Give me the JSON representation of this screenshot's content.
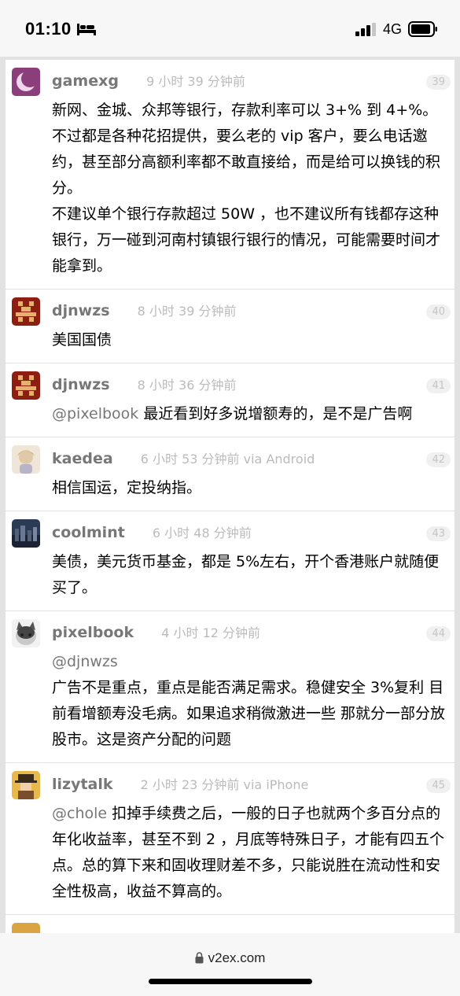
{
  "status_bar": {
    "time": "01:10",
    "network": "4G"
  },
  "browser": {
    "url": "v2ex.com"
  },
  "replies": [
    {
      "username": "gamexg",
      "time": "9 小时 39 分钟前",
      "floor": "39",
      "paragraphs": [
        "新网、金城、众邦等银行，存款利率可以 3+% 到 4+%。",
        "不过都是各种花招提供，要么老的 vip 客户，要么电话邀约，甚至部分高额利率都不敢直接给，而是给可以换钱的积分。",
        "不建议单个银行存款超过 50W ，也不建议所有钱都存这种银行，万一碰到河南村镇银行银行的情况，可能需要时间才能拿到。"
      ]
    },
    {
      "username": "djnwzs",
      "time": "8 小时 39 分钟前",
      "floor": "40",
      "paragraphs": [
        "美国国债"
      ]
    },
    {
      "username": "djnwzs",
      "time": "8 小时 36 分钟前",
      "floor": "41",
      "mention": "@pixelbook",
      "paragraphs": [
        " 最近看到好多说增额寿的，是不是广告啊"
      ]
    },
    {
      "username": "kaedea",
      "time": "6 小时 53 分钟前 via Android",
      "floor": "42",
      "paragraphs": [
        "相信国运，定投纳指。"
      ]
    },
    {
      "username": "coolmint",
      "time": "6 小时 48 分钟前",
      "floor": "43",
      "paragraphs": [
        "美债，美元货币基金，都是 5%左右，开个香港账户就随便买了。"
      ]
    },
    {
      "username": "pixelbook",
      "time": "4 小时 12 分钟前",
      "floor": "44",
      "mention_line": "@djnwzs",
      "paragraphs": [
        "广告不是重点，重点是能否满足需求。稳健安全 3%复利 目前看增额寿没毛病。如果追求稍微激进一些 那就分一部分放股市。这是资产分配的问题"
      ]
    },
    {
      "username": "lizytalk",
      "time": "2 小时 23 分钟前 via iPhone",
      "floor": "45",
      "mention": "@chole",
      "paragraphs": [
        " 扣掉手续费之后，一般的日子也就两个多百分点的年化收益率，甚至不到 2 ，月底等特殊日子，才能有四五个点。总的算下来和固收理财差不多，只能说胜在流动性和安全性极高，收益不算高的。"
      ]
    }
  ],
  "colors": {
    "username": "#777777",
    "time": "#bbbbbb",
    "page_bg": "#e2e2e2",
    "card_bg": "#ffffff"
  },
  "icons": [
    "bed-icon",
    "signal-icon",
    "battery-icon",
    "lock-icon"
  ]
}
